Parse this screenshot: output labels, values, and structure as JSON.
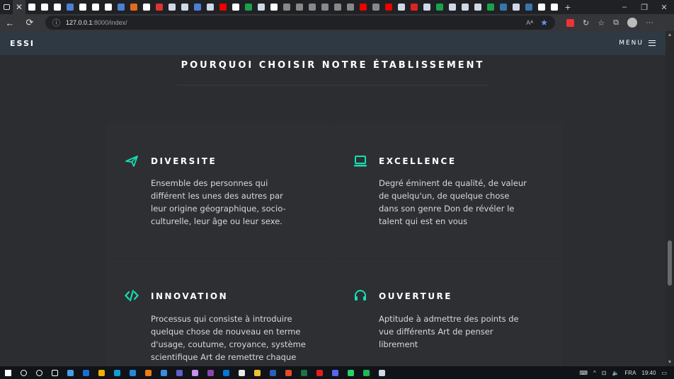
{
  "browser": {
    "tab_colors": [
      "#ffffff",
      "#ffffff",
      "#ffffff",
      "#4a7fd6",
      "#ffffff",
      "#ffffff",
      "#ffffff",
      "#4a7fd6",
      "#e06c1a",
      "#ffffff",
      "#d33",
      "#cfd8e6",
      "#cfd8e6",
      "#4a7fd6",
      "#cfd8e6",
      "#e00",
      "#ffffff",
      "#18a34a",
      "#cfd8e6",
      "#ffffff",
      "#888",
      "#888",
      "#888",
      "#888",
      "#888",
      "#888",
      "#e00",
      "#888",
      "#e00",
      "#cfd8e6",
      "#d22",
      "#cfd8e6",
      "#18a34a",
      "#cfd8e6",
      "#cfd8e6",
      "#cfd8e6",
      "#18a34a",
      "#3776ab",
      "#cfd8e6",
      "#3776ab",
      "#ffffff",
      "#ffffff"
    ],
    "url_host": "127.0.0.1",
    "url_path": ":8000/index/",
    "read_aloud": "Aᴬ"
  },
  "site": {
    "brand": "ESSI",
    "menu_label": "MENU"
  },
  "section": {
    "title": "POURQUOI CHOISIR NOTRE ÉTABLISSEMENT"
  },
  "features": [
    {
      "icon": "paper-plane-icon",
      "title": "DIVERSITE",
      "text": "Ensemble des personnes qui différent les unes des autres par leur origine géographique, socio-culturelle, leur âge ou leur sexe."
    },
    {
      "icon": "laptop-icon",
      "title": "EXCELLENCE",
      "text": "Degré éminent de qualité, de valeur de quelqu'un, de quelque chose dans son genre Don de révéler le talent qui est en vous"
    },
    {
      "icon": "code-icon",
      "title": "INNOVATION",
      "text": "Processus qui consiste à introduire quelque chose de nouveau en terme d'usage, coutume, croyance, système scientifique Art de remettre chaque"
    },
    {
      "icon": "headphones-icon",
      "title": "OUVERTURE",
      "text": "Aptitude à admettre des points de vue différents Art de penser librement"
    }
  ],
  "accent_color": "#14e0b4",
  "taskbar": {
    "language": "FRA",
    "time": "19:40",
    "app_colors": [
      "#4a9ee8",
      "#1a6fd6",
      "#f0b000",
      "#0f9bd7",
      "#1d8ae0",
      "#f07c10",
      "#3b8de0",
      "#5b5fc7",
      "#c78ff0",
      "#8e44ad",
      "#0078d4",
      "#e8e8e8",
      "#f0c030",
      "#2b5eb8",
      "#e34c26",
      "#1e7145",
      "#e02020",
      "#5865f2",
      "#25d366",
      "#1db954",
      "#cfd8e6"
    ]
  }
}
